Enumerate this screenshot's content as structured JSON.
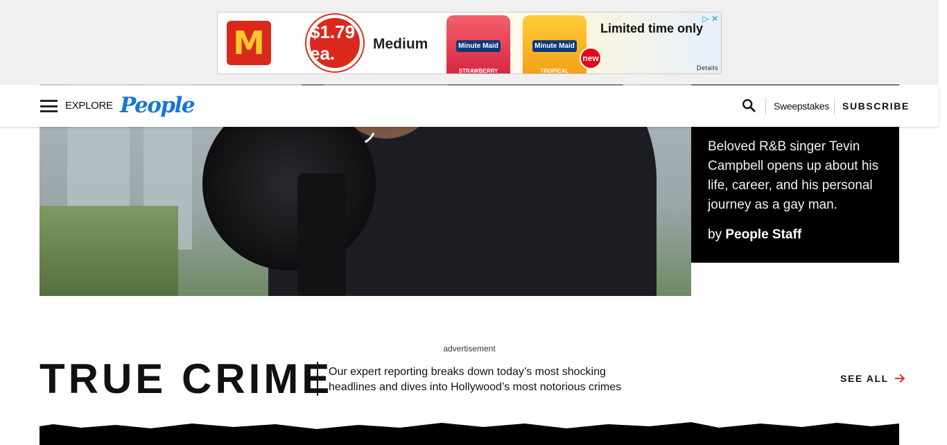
{
  "ad": {
    "brand_letter": "M",
    "price": "$1.79 ea.",
    "size": "Medium",
    "product1_brand": "Minute Maid",
    "product1_flavor": "STRAWBERRY WATERMELON SLUSHIE",
    "product2_brand": "Minute Maid",
    "product2_flavor": "TROPICAL MANGO SLUSHIE",
    "new_badge": "new",
    "headline": "Limited time only",
    "details": "Details",
    "adchoices_label": "▷ ✕"
  },
  "header": {
    "explore_label": "EXPLORE",
    "logo_text": "People",
    "sweepstakes_label": "Sweepstakes",
    "subscribe_label": "SUBSCRIBE"
  },
  "promo": {
    "description": "Beloved R&B singer Tevin Campbell opens up about his life, career, and his personal journey as a gay man.",
    "by_prefix": "by",
    "author": "People Staff"
  },
  "section": {
    "advertisement_label": "advertisement",
    "title": "TRUE CRIME",
    "description": "Our expert reporting breaks down today’s most shocking headlines and dives into Hollywood’s most notorious crimes",
    "see_all_label": "SEE ALL"
  },
  "colors": {
    "logo_blue": "#1976d2",
    "arrow_red": "#e03131",
    "mcd_red": "#da291c",
    "mcd_yellow": "#ffc72c"
  }
}
